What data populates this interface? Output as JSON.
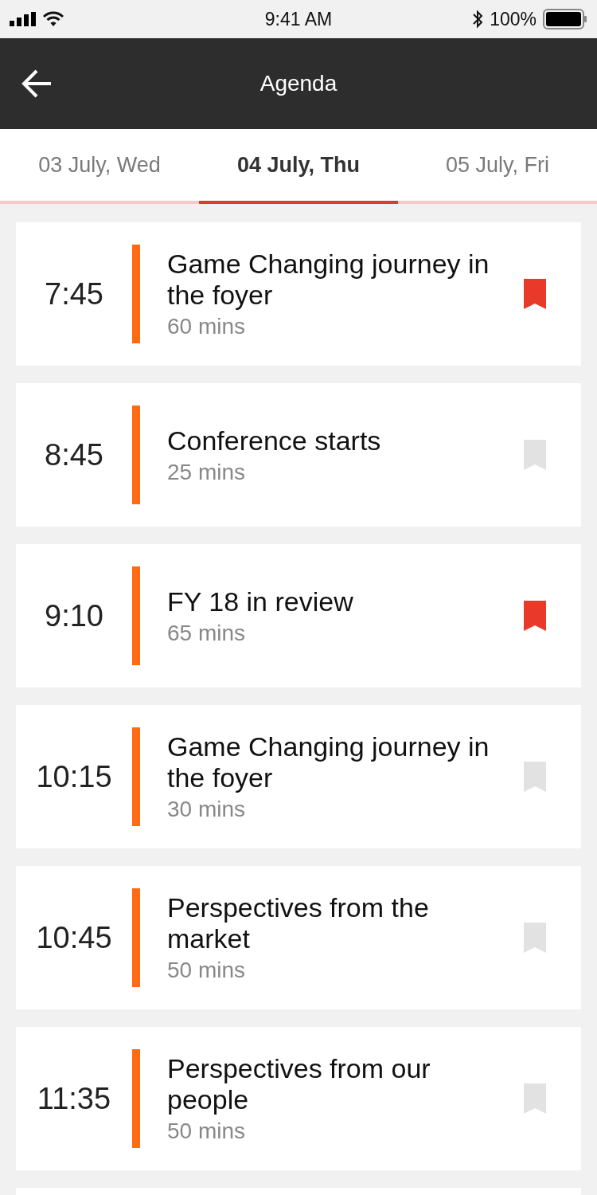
{
  "status_bar": {
    "time": "9:41 AM",
    "battery": "100%"
  },
  "header": {
    "title": "Agenda"
  },
  "tabs": [
    {
      "label": "03 July, Wed",
      "selected": false
    },
    {
      "label": "04 July, Thu",
      "selected": true
    },
    {
      "label": "05 July, Fri",
      "selected": false
    }
  ],
  "sessions": [
    {
      "time": "7:45",
      "title": "Game Changing journey in the foyer",
      "duration": "60 mins",
      "bookmarked": true
    },
    {
      "time": "8:45",
      "title": "Conference starts",
      "duration": "25 mins",
      "bookmarked": false
    },
    {
      "time": "9:10",
      "title": "FY 18 in review",
      "duration": "65 mins",
      "bookmarked": true
    },
    {
      "time": "10:15",
      "title": "Game Changing journey in the foyer",
      "duration": "30 mins",
      "bookmarked": false
    },
    {
      "time": "10:45",
      "title": "Perspectives from the market",
      "duration": "50 mins",
      "bookmarked": false
    },
    {
      "time": "11:35",
      "title": "Perspectives from our people",
      "duration": "50 mins",
      "bookmarked": false
    }
  ]
}
